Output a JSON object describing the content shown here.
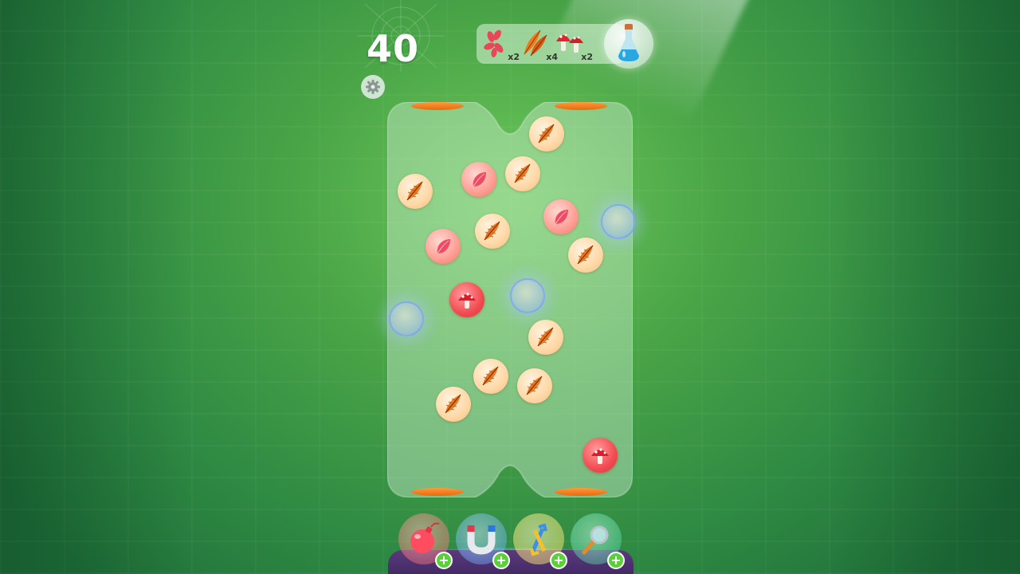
{
  "hud": {
    "score": "40",
    "settings_icon": "gear-icon"
  },
  "recipe": {
    "items": [
      {
        "ingredient": "petal",
        "icon": "petal-cluster-icon",
        "count": "x2"
      },
      {
        "ingredient": "feather",
        "icon": "feathers-icon",
        "count": "x4"
      },
      {
        "ingredient": "mushroom",
        "icon": "mushrooms-icon",
        "count": "x2"
      }
    ],
    "target_icon": "potion-bottle-icon"
  },
  "board": {
    "balls": [
      {
        "kind": "feather"
      },
      {
        "kind": "petal"
      },
      {
        "kind": "feather"
      },
      {
        "kind": "feather"
      },
      {
        "kind": "petal"
      },
      {
        "kind": "bubble"
      },
      {
        "kind": "petal"
      },
      {
        "kind": "feather"
      },
      {
        "kind": "feather"
      },
      {
        "kind": "mushroom"
      },
      {
        "kind": "bubble"
      },
      {
        "kind": "bubble"
      },
      {
        "kind": "feather"
      },
      {
        "kind": "feather"
      },
      {
        "kind": "feather"
      },
      {
        "kind": "feather"
      },
      {
        "kind": "mushroom"
      }
    ]
  },
  "powerups": [
    {
      "name": "bomb",
      "icon": "bomb-icon",
      "add_label": "+"
    },
    {
      "name": "magnet",
      "icon": "magnet-icon",
      "add_label": "+"
    },
    {
      "name": "swap",
      "icon": "swap-arrows-icon",
      "add_label": "+"
    },
    {
      "name": "magnifier",
      "icon": "magnifier-icon",
      "add_label": "+"
    }
  ],
  "colors": {
    "background": "#4aa547",
    "jar_glass": "#c8ecd0",
    "cap_orange": "#f07a1c",
    "plus_green": "#5ccf3a"
  }
}
